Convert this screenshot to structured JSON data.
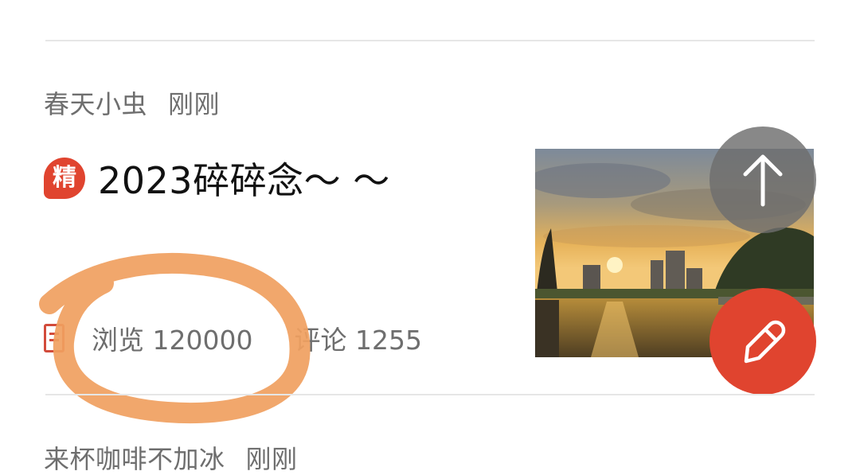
{
  "posts": [
    {
      "author": "春天小虫",
      "time": "刚刚",
      "badge": "精",
      "title": "2023碎碎念～ ～",
      "views_label": "浏览",
      "views_count": "120000",
      "comments_label": "评论",
      "comments_count": "1255",
      "thumbnail_icon": "sunset-river-photo"
    },
    {
      "author": "来杯咖啡不加冰",
      "time": "刚刚"
    }
  ],
  "fabs": {
    "scroll_top_icon": "arrow-up-icon",
    "compose_icon": "pencil-icon"
  },
  "colors": {
    "accent_red": "#e0442f",
    "annotation_orange": "#f0a060",
    "meta_gray": "#6e6e6e"
  }
}
